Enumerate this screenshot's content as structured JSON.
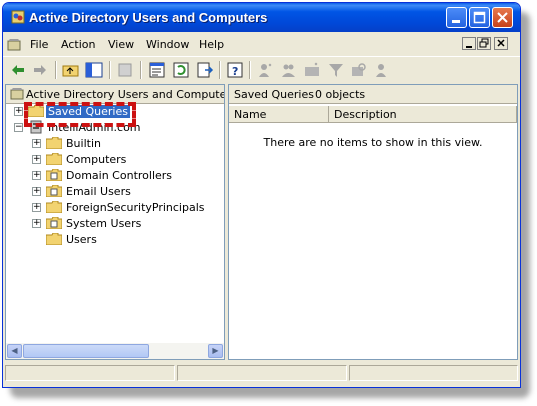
{
  "window": {
    "title": "Active Directory Users and Computers"
  },
  "menu": [
    {
      "label": "File"
    },
    {
      "label": "Action"
    },
    {
      "label": "View"
    },
    {
      "label": "Window"
    },
    {
      "label": "Help"
    }
  ],
  "tree": {
    "header": "Active Directory Users and Computers [v",
    "saved_queries": "Saved Queries",
    "domain": "IntelliAdmin.com",
    "children": [
      "Builtin",
      "Computers",
      "Domain Controllers",
      "Email Users",
      "ForeignSecurityPrincipals",
      "System Users",
      "Users"
    ]
  },
  "right": {
    "header_title": "Saved Queries",
    "header_count": "0 objects",
    "columns": [
      "Name",
      "Description"
    ],
    "empty_message": "There are no items to show in this view."
  },
  "colors": {
    "title_blue": "#0055e5",
    "selection": "#316ac5",
    "highlight_box": "#cc1111"
  }
}
